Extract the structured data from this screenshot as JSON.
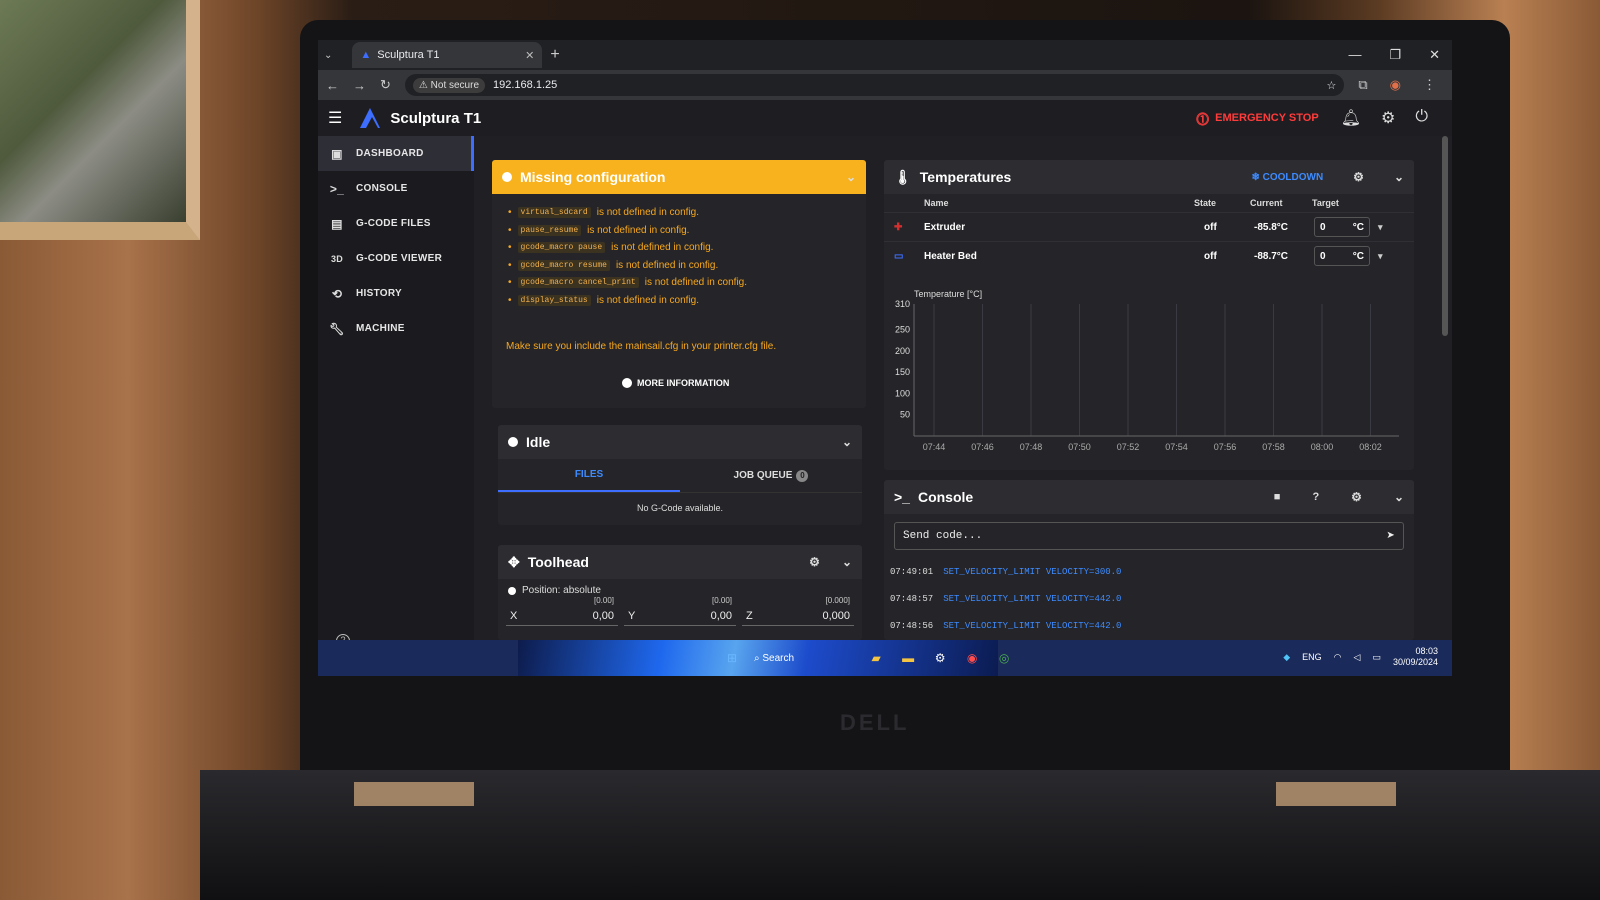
{
  "browser": {
    "tab_title": "Sculptura T1",
    "new_tab": "+",
    "not_secure": "Not secure",
    "url": "192.168.1.25"
  },
  "app": {
    "title": "Sculptura T1",
    "emergency_stop": "EMERGENCY STOP"
  },
  "sidebar": {
    "items": [
      {
        "label": "DASHBOARD",
        "icon": "monitor-icon",
        "active": true
      },
      {
        "label": "CONSOLE",
        "icon": "console-icon"
      },
      {
        "label": "G-CODE FILES",
        "icon": "file-icon"
      },
      {
        "label": "G-CODE VIEWER",
        "icon": "3d-icon"
      },
      {
        "label": "HISTORY",
        "icon": "history-icon"
      },
      {
        "label": "MACHINE",
        "icon": "wrench-icon"
      }
    ]
  },
  "warning": {
    "title": "Missing configuration",
    "items": [
      {
        "code": "virtual_sdcard",
        "text": "is not defined in config."
      },
      {
        "code": "pause_resume",
        "text": "is not defined in config."
      },
      {
        "code": "gcode_macro pause",
        "text": "is not defined in config."
      },
      {
        "code": "gcode_macro resume",
        "text": "is not defined in config."
      },
      {
        "code": "gcode_macro cancel_print",
        "text": "is not defined in config."
      },
      {
        "code": "display_status",
        "text": "is not defined in config."
      }
    ],
    "note": "Make sure you include the mainsail.cfg in your printer.cfg file.",
    "more_info": "MORE INFORMATION"
  },
  "status": {
    "title": "Idle",
    "tab_files": "FILES",
    "tab_queue": "JOB QUEUE",
    "queue_count": "0",
    "empty": "No G-Code available."
  },
  "toolhead": {
    "title": "Toolhead",
    "position_mode": "Position: absolute",
    "axes": [
      {
        "label": "X",
        "value": "0,00",
        "target": "[0.00]"
      },
      {
        "label": "Y",
        "value": "0,00",
        "target": "[0.00]"
      },
      {
        "label": "Z",
        "value": "0,000",
        "target": "[0.000]"
      }
    ]
  },
  "temperatures": {
    "title": "Temperatures",
    "cooldown": "COOLDOWN",
    "col_name": "Name",
    "col_state": "State",
    "col_current": "Current",
    "col_target": "Target",
    "rows": [
      {
        "name": "Extruder",
        "state": "off",
        "current": "-85.8°C",
        "target": "0",
        "unit": "°C"
      },
      {
        "name": "Heater Bed",
        "state": "off",
        "current": "-88.7°C",
        "target": "0",
        "unit": "°C"
      }
    ]
  },
  "chart_data": {
    "type": "line",
    "ylabel": "Temperature [°C]",
    "yticks": [
      50,
      100,
      150,
      200,
      250,
      310
    ],
    "ylim": [
      0,
      310
    ],
    "x": [
      "07:44",
      "07:46",
      "07:48",
      "07:50",
      "07:52",
      "07:54",
      "07:56",
      "07:58",
      "08:00",
      "08:02"
    ],
    "series": [],
    "grid": true
  },
  "console": {
    "title": "Console",
    "placeholder": "Send code...",
    "lines": [
      {
        "time": "07:49:01",
        "cmd": "SET_VELOCITY_LIMIT VELOCITY=300.0"
      },
      {
        "time": "07:48:57",
        "cmd": "SET_VELOCITY_LIMIT VELOCITY=442.0"
      },
      {
        "time": "07:48:56",
        "cmd": "SET_VELOCITY_LIMIT VELOCITY=442.0"
      }
    ]
  },
  "taskbar": {
    "search": "Search",
    "lang": "ENG",
    "time": "08:03",
    "date": "30/09/2024"
  },
  "photo": {
    "brand": "DELL"
  },
  "colors": {
    "accent": "#3d6eff",
    "warning": "#f7b21d",
    "danger": "#ff3b3b"
  }
}
